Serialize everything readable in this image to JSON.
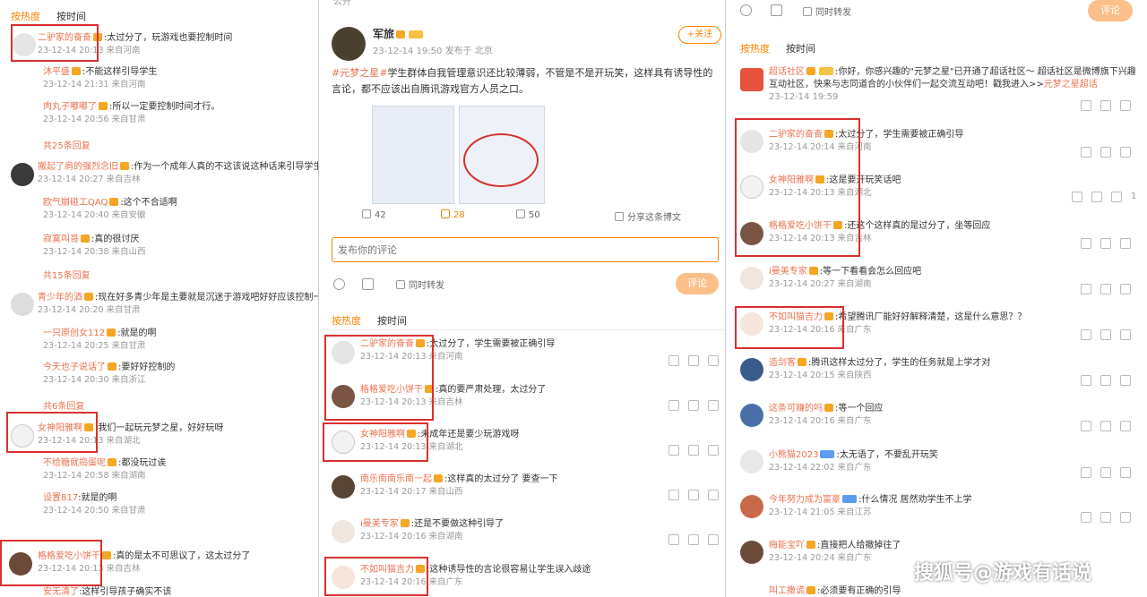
{
  "left": {
    "tabs": [
      "按热度",
      "按时间"
    ],
    "comments": [
      {
        "name": "二驴家的奋奋",
        "text": ":太过分了，玩游戏也要控制时间",
        "meta": "23-12-14 20:13 来自河南"
      },
      {
        "name": "沐平盛",
        "text": ":不能这样引导学生",
        "meta": "23-12-14 21:31 来自河南"
      },
      {
        "name": "肉丸子嘟嘟了",
        "text": ":所以一定要控制时间才行。",
        "meta": "23-12-14 20:56 来自甘肃"
      },
      {
        "name": "搬起了肩的强烈念旧",
        "text": ":作为一个成年人真的不这该说这种话来引导学生",
        "meta": "23-12-14 20:27 来自吉林"
      },
      {
        "name": "欧气崩碰工QAQ",
        "text": ":这个不合适啊",
        "meta": "23-12-14 20:40 来自安徽"
      },
      {
        "name": "寂寞叫哥",
        "text": ":真的很讨厌",
        "meta": "23-12-14 20:38 来自山西"
      },
      {
        "name": "青少年的酒",
        "text": ":现在好多青少年是主要就是沉迷于游戏吧好好应该控制一下",
        "meta": "23-12-14 20:20 来自甘肃"
      },
      {
        "name": "一只原创女112",
        "text": ":就是的啊",
        "meta": "23-12-14 20:25 来自甘肃"
      },
      {
        "name": "今天也子说话了",
        "text": ":要好好控制的",
        "meta": "23-12-14 20:30 来自浙江"
      },
      {
        "name": "女神阳雅啊",
        "text": ":我们一起玩元梦之星，好好玩呀",
        "meta": "23-12-14 20:13 来自湖北"
      },
      {
        "name": "不给糖就捣蛋呢",
        "text": ":都没玩过诶",
        "meta": "23-12-14 20:58 来自湖南"
      },
      {
        "name": "设置817",
        "text": ":就是的啊",
        "meta": "23-12-14 20:50 来自甘肃"
      },
      {
        "name": "格格爱吃小饼干",
        "text": ":真的是太不可思议了，这太过分了",
        "meta": "23-12-14 20:13 来自吉林"
      },
      {
        "name": "安无清了",
        "text": ":这样引导孩子确实不该",
        "meta": ""
      }
    ],
    "more": [
      "共25条回复",
      "共15条回复",
      "共6条回复"
    ]
  },
  "mid": {
    "top_label": "公开",
    "author": "军旅",
    "follow_label": "+关注",
    "post_meta": "23-12-14 19:50 发布于 北京",
    "post_tag": "#元梦之星#",
    "post_text": "学生群体自我管理意识还比较薄弱，不管是不是开玩笑，这样具有诱导性的言论，都不应该出自腾讯游戏官方人员之口。",
    "stats": {
      "repost": "42",
      "comment": "28",
      "like": "50"
    },
    "share_label": "分享这条博文",
    "comment_placeholder": "发布你的评论",
    "sync_label": "同时转发",
    "submit_label": "评论",
    "tabs": [
      "按热度",
      "按时间"
    ],
    "comments": [
      {
        "name": "二驴家的奋奋",
        "text": ":太过分了，学生需要被正确引导",
        "meta": "23-12-14 20:13 来自河南"
      },
      {
        "name": "格格爱吃小饼干",
        "text": ":真的要严肃处理，太过分了",
        "meta": "23-12-14 20:13 来自吉林"
      },
      {
        "name": "女神阳雅啊",
        "text": ":未成年还是要少玩游戏呀",
        "meta": "23-12-14 20:13 来自湖北"
      },
      {
        "name": "南乐南南乐南一起",
        "text": ":这样真的太过分了 要查一下",
        "meta": "23-12-14 20:17 来自山西"
      },
      {
        "name": "i曼美专家",
        "text": ":还是不要做这种引导了",
        "meta": "23-12-14 20:16 来自湖南"
      },
      {
        "name": "不如叫猫吉力",
        "text": ":这种诱导性的言论很容易让学生误入歧途",
        "meta": "23-12-14 20:16 来自广东"
      }
    ]
  },
  "right": {
    "sync_label": "同时转发",
    "submit_label": "评论",
    "tabs": [
      "按热度",
      "按时间"
    ],
    "super_topic": {
      "name": "超话社区",
      "text": ":你好，你感兴趣的\"元梦之星\"已开通了超话社区～ 超话社区是微博旗下兴趣互动社区，快来与志同道合的小伙伴们一起交流互动吧！戳我进入>>",
      "link": "元梦之星超话",
      "meta": "23-12-14 19:59"
    },
    "comments": [
      {
        "name": "二驴家的奋奋",
        "text": ":太过分了，学生需要被正确引导",
        "meta": "23-12-14 20:14 来自河南",
        "like": ""
      },
      {
        "name": "女神阳雅啊",
        "text": ":这是要开玩笑话吧",
        "meta": "23-12-14 20:13 来自湖北",
        "like": "1"
      },
      {
        "name": "格格爱吃小饼干",
        "text": ":还这个这样真的是过分了，坐等回应",
        "meta": "23-12-14 20:13 来自吉林",
        "like": ""
      },
      {
        "name": "i曼美专家",
        "text": ":等一下看看会怎么回应吧",
        "meta": "23-12-14 20:27 来自湖南",
        "like": ""
      },
      {
        "name": "不如叫猫吉力",
        "text": ":希望腾讯厂能好好解释清楚，这是什么意思？？",
        "meta": "23-12-14 20:16 来自广东",
        "like": ""
      },
      {
        "name": "造剑客",
        "text": ":腾讯这样太过分了，学生的任务就是上学才对",
        "meta": "23-12-14 20:15 来自陕西",
        "like": ""
      },
      {
        "name": "这条可赚的吗",
        "text": ":等一个回应",
        "meta": "23-12-14 20:16 来自广东",
        "like": ""
      },
      {
        "name": "小熊猫2023",
        "text": ":太无语了，不要乱开玩笑",
        "meta": "23-12-14 22:02 来自广东",
        "like": ""
      },
      {
        "name": "今年努力成为富豪",
        "text": ":什么情况 居然劝学生不上学",
        "meta": "23-12-14 21:05 来自江苏",
        "like": ""
      },
      {
        "name": "梅能宝吖",
        "text": ":直接把人给撤掉往了",
        "meta": "23-12-14 20:24 来自广东",
        "like": ""
      },
      {
        "name": "叫工撒谎",
        "text": ":必须要有正确的引导",
        "meta": ""
      }
    ]
  },
  "watermark": "搜狐号@游戏有话说",
  "colors": {
    "accent": "#ff8200",
    "name": "#eb7350",
    "highlight": "#d93030"
  }
}
